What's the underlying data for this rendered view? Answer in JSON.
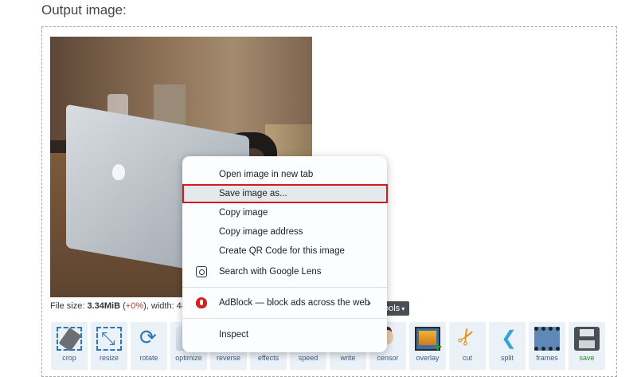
{
  "section": {
    "title": "Output image:"
  },
  "file_info": {
    "prefix": "File size: ",
    "size": "3.34MiB",
    "delta_open": " (",
    "delta": "+0%",
    "delta_close": "), width: 480p"
  },
  "tools_button": {
    "label": "ools",
    "caret": "▾"
  },
  "toolbar": {
    "tools": [
      {
        "label": "crop",
        "icon": "crop-icon"
      },
      {
        "label": "resize",
        "icon": "resize-icon"
      },
      {
        "label": "rotate",
        "icon": "rotate-icon"
      },
      {
        "label": "optimize",
        "icon": "optimize-icon"
      },
      {
        "label": "reverse",
        "icon": "reverse-icon"
      },
      {
        "label": "effects",
        "icon": "effects-icon"
      },
      {
        "label": "speed",
        "icon": "speed-icon"
      },
      {
        "label": "write",
        "icon": "write-icon"
      },
      {
        "label": "censor",
        "icon": "censor-icon"
      },
      {
        "label": "overlay",
        "icon": "overlay-icon"
      },
      {
        "label": "cut",
        "icon": "scissors-icon"
      },
      {
        "label": "split",
        "icon": "split-icon"
      },
      {
        "label": "frames",
        "icon": "film-strip-icon"
      },
      {
        "label": "save",
        "icon": "floppy-disk-icon"
      }
    ]
  },
  "context_menu": {
    "items": [
      {
        "label": "Open image in new tab"
      },
      {
        "label": "Save image as..."
      },
      {
        "label": "Copy image"
      },
      {
        "label": "Copy image address"
      },
      {
        "label": "Create QR Code for this image"
      },
      {
        "label": "Search with Google Lens",
        "icon": "google-lens-icon"
      },
      {
        "label": "AdBlock — block ads across the web",
        "icon": "adblock-icon",
        "submenu": "›"
      },
      {
        "label": "Inspect"
      }
    ],
    "highlight_color": "#d01c1f"
  }
}
